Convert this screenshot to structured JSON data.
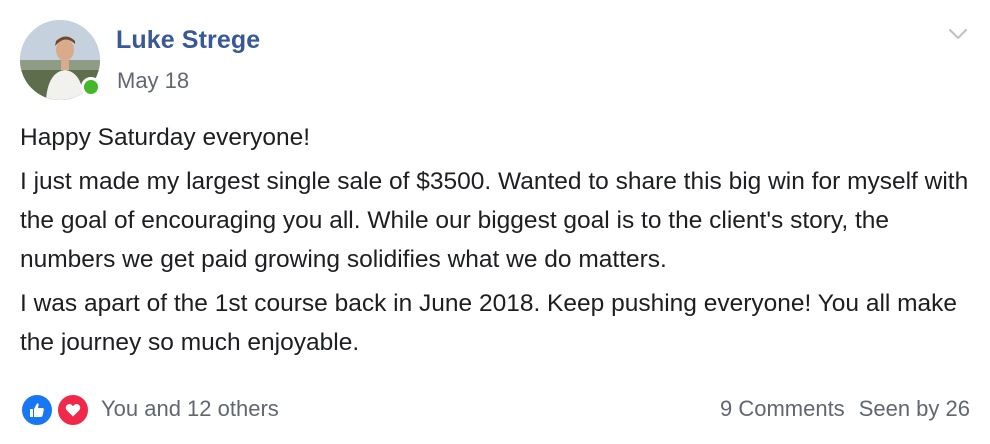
{
  "post": {
    "author": "Luke Strege",
    "date": "May 18",
    "paragraphs": [
      "Happy Saturday everyone!",
      "I just made my largest single sale of $3500. Wanted to share this big win for myself with the goal of encouraging you all. While our biggest goal is to the client's story, the numbers we get paid growing solidifies what we do matters.",
      "I was apart of the 1st course back in June 2018. Keep pushing everyone! You all make the journey so much enjoyable."
    ],
    "presence": "online",
    "reactions": {
      "icons": [
        "like-icon",
        "love-icon"
      ],
      "summary": "You and 12 others"
    },
    "comments": "9 Comments",
    "seen_by": "Seen by 26"
  },
  "colors": {
    "author": "#385898",
    "presence": "#42b72a",
    "like": "#1877f2",
    "love": "#f0284a",
    "muted": "#606770"
  }
}
